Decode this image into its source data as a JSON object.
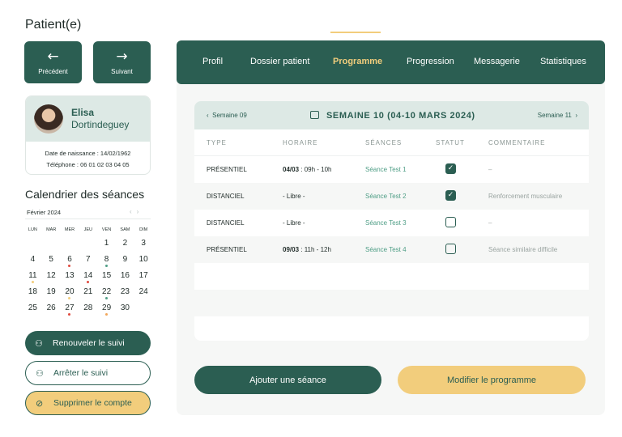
{
  "page": {
    "title": "Patient(e)"
  },
  "navigation": {
    "previous": {
      "icon": "arrow-left-icon",
      "label": "Précédent"
    },
    "next": {
      "icon": "arrow-right-icon",
      "label": "Suivant"
    }
  },
  "patient": {
    "first_name": "Elisa",
    "last_name": "Dortindeguey",
    "birth_date": "Date de naissance :  14/02/1962",
    "phone": "Téléphone : 06 01 02 03 04 05"
  },
  "calendar": {
    "title": "Calendrier des séances",
    "month": "Février 2024",
    "weekdays": [
      "LUN",
      "MAR",
      "MER",
      "JEU",
      "VEN",
      "SAM",
      "DIM"
    ],
    "weeks": [
      [
        "",
        "",
        "",
        "",
        "1",
        "2",
        "3"
      ],
      [
        "4",
        "5",
        "6",
        "7",
        "8",
        "9",
        "10"
      ],
      [
        "11",
        "12",
        "13",
        "14",
        "15",
        "16",
        "17"
      ],
      [
        "18",
        "19",
        "20",
        "21",
        "22",
        "23",
        "24"
      ],
      [
        "25",
        "26",
        "27",
        "28",
        "29",
        "30",
        ""
      ]
    ],
    "dots": [
      {
        "day": "6",
        "color": "#e04a3f"
      },
      {
        "day": "8",
        "color": "#4f9e86"
      },
      {
        "day": "11",
        "color": "#f2cd7c"
      },
      {
        "day": "14",
        "color": "#e04a3f"
      },
      {
        "day": "20",
        "color": "#f2cd7c"
      },
      {
        "day": "22",
        "color": "#4f9e86"
      },
      {
        "day": "27",
        "color": "#e04a3f"
      },
      {
        "day": "29",
        "color": "#f2a65a"
      }
    ]
  },
  "actions": {
    "renew": {
      "label": "Renouveler le suivi",
      "icon": "user-refresh-icon"
    },
    "stop": {
      "label": "Arrêter le suivi",
      "icon": "user-stop-icon"
    },
    "delete": {
      "label": "Supprimer le compte",
      "icon": "ban-icon"
    }
  },
  "tabs": [
    {
      "label": "Profil"
    },
    {
      "label": "Dossier patient"
    },
    {
      "label": "Programme",
      "active": true
    },
    {
      "label": "Progression"
    },
    {
      "label": "Messagerie"
    },
    {
      "label": "Statistiques"
    }
  ],
  "program": {
    "week_prev": "Semaine 09",
    "week_title": "SEMAINE 10 (04-10 MARS 2024)",
    "week_next": "Semaine 11",
    "columns": [
      "TYPE",
      "HORAIRE",
      "SÉANCES",
      "STATUT",
      "COMMENTAIRE"
    ],
    "rows": [
      {
        "type": "PRÉSENTIEL",
        "date": "04/03",
        "time": " : 09h - 10h",
        "seance": "Séance Test 1",
        "done": true,
        "comment": "–"
      },
      {
        "type": "DISTANCIEL",
        "date": "",
        "time": "- Libre -",
        "seance": "Séance Test 2",
        "done": true,
        "comment": "Renforcement musculaire"
      },
      {
        "type": "DISTANCIEL",
        "date": "",
        "time": "- Libre -",
        "seance": "Séance Test 3",
        "done": false,
        "comment": "–"
      },
      {
        "type": "PRÉSENTIEL",
        "date": "09/03",
        "time": " : 11h - 12h",
        "seance": "Séance Test 4",
        "done": false,
        "comment": "Séance similaire difficile"
      }
    ],
    "add_label": "Ajouter une séance",
    "edit_label": "Modifier le programme"
  },
  "colors": {
    "primary": "#2b5e52",
    "accent": "#f2cd7c",
    "light": "#dde9e5"
  }
}
